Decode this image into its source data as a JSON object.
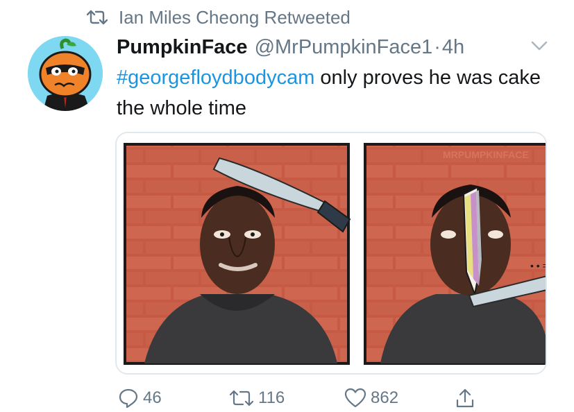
{
  "retweet": {
    "label": "Ian Miles Cheong Retweeted",
    "icon": "retweet-icon"
  },
  "tweet": {
    "display_name": "PumpkinFace",
    "handle": "@MrPumpkinFace1",
    "separator": "·",
    "time": "4h",
    "hashtag": "#georgefloydbodycam",
    "text_rest": " only proves he was cake the whole time",
    "watermark": "MRPUMPKINFACE"
  },
  "actions": {
    "replies": "46",
    "retweets": "116",
    "likes": "862"
  },
  "colors": {
    "link": "#1b95e0",
    "muted": "#657786",
    "text": "#14171a",
    "brick": "#c0503a"
  }
}
